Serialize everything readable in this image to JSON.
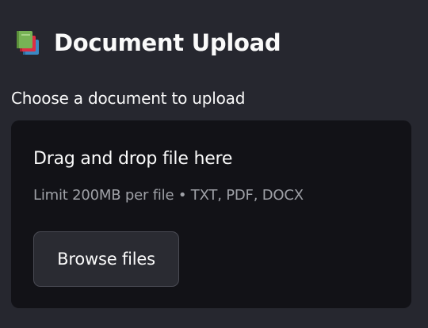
{
  "header": {
    "icon": "books-icon",
    "title": "Document Upload"
  },
  "uploader": {
    "label": "Choose a document to upload",
    "drop_instructions": "Drag and drop file here",
    "limit_text": "Limit 200MB per file • TXT, PDF, DOCX",
    "browse_label": "Browse files"
  },
  "colors": {
    "background": "#26272f",
    "dropzone": "#121217",
    "text": "#fafafa",
    "muted_text": "#9fa1a7",
    "button_bg": "#2a2b32",
    "button_border": "#4a4b54"
  }
}
